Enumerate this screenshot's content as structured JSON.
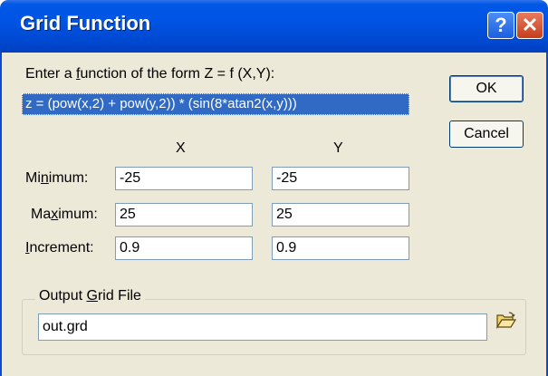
{
  "title_bar": {
    "title": "Grid Function",
    "help": "?",
    "close": "✕"
  },
  "function": {
    "prompt_pre": "Enter a ",
    "prompt_u": "f",
    "prompt_post": "unction of the form Z = f (X,Y):",
    "value": "z = (pow(x,2) + pow(y,2)) * (sin(8*atan2(x,y)))"
  },
  "buttons": {
    "ok": "OK",
    "cancel": "Cancel"
  },
  "columns": {
    "x": "X",
    "y": "Y"
  },
  "rows": [
    {
      "pre": "Mi",
      "u": "n",
      "post": "imum:",
      "x": "-25",
      "y": "-25"
    },
    {
      "pre": "Ma",
      "u": "x",
      "post": "imum:",
      "x": "25",
      "y": "25"
    },
    {
      "pre": "",
      "u": "I",
      "post": "ncrement:",
      "x": "0.9",
      "y": "0.9"
    }
  ],
  "output": {
    "group_pre": "Output ",
    "group_u": "G",
    "group_post": "rid File",
    "value": "out.grd",
    "browse_icon": "folder-open-icon"
  }
}
